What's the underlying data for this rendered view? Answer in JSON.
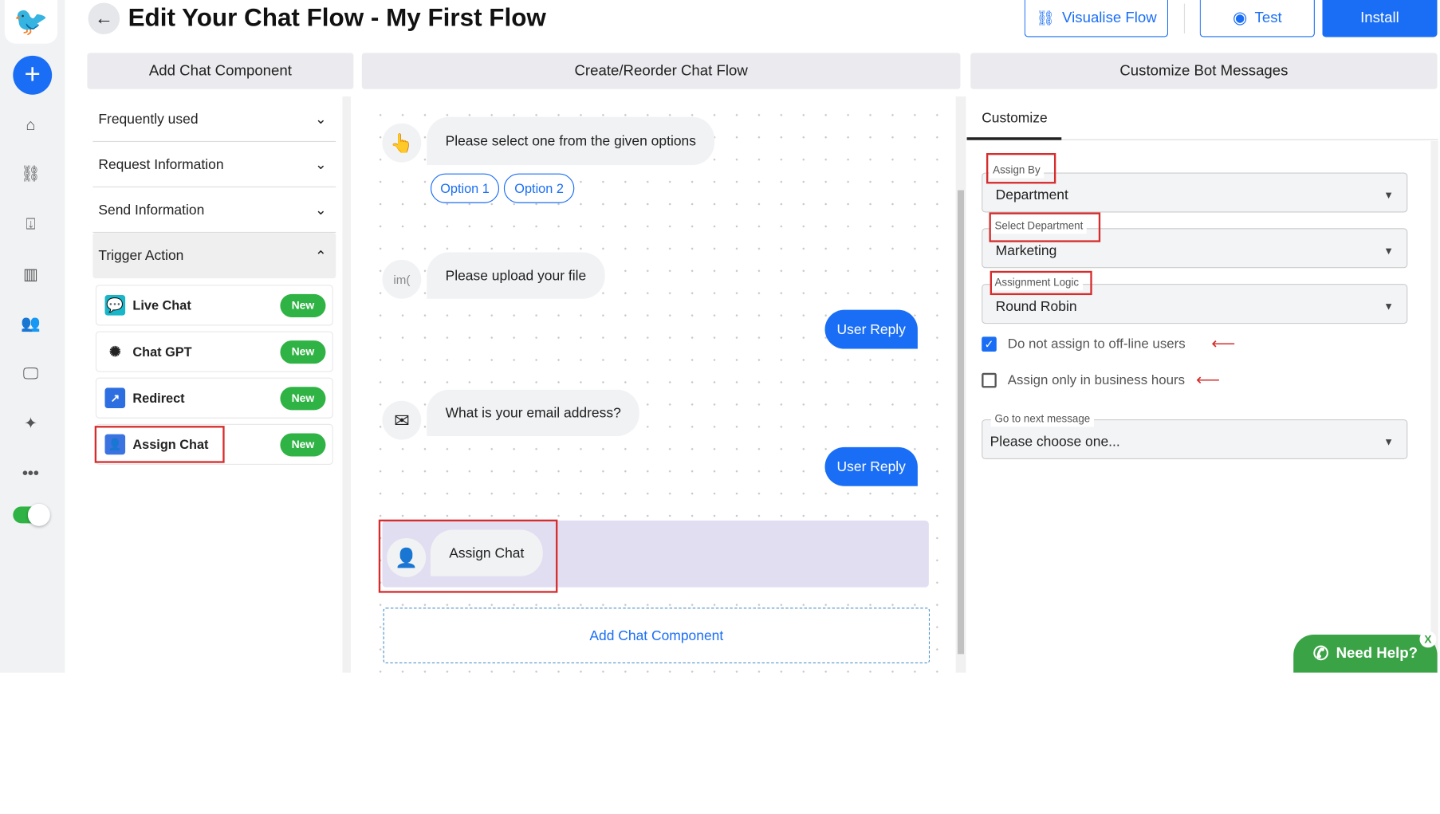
{
  "header": {
    "title": "Edit Your Chat Flow - My First Flow",
    "visualise_label": "Visualise Flow",
    "test_label": "Test",
    "install_label": "Install"
  },
  "colors": {
    "primary": "#1a6ef5",
    "new_badge": "#2fb344",
    "highlight": "#d62c2c",
    "selected_row": "#e2def2",
    "whatsapp": "#3aa346"
  },
  "sidebar": {
    "icons": [
      "logo-icon",
      "plus-icon",
      "home-icon",
      "flow-icon",
      "inbox-icon",
      "analytics-icon",
      "team-icon",
      "monitor-icon",
      "ticket-icon",
      "more-icon"
    ],
    "toggle_on": true
  },
  "left_panel": {
    "header": "Add Chat Component",
    "sections": [
      {
        "label": "Frequently used"
      },
      {
        "label": "Request Information"
      },
      {
        "label": "Send Information"
      },
      {
        "label": "Trigger Action"
      }
    ],
    "components": [
      {
        "label": "Live Chat",
        "badge": "New"
      },
      {
        "label": "Chat GPT",
        "badge": "New"
      },
      {
        "label": "Redirect",
        "badge": "New"
      },
      {
        "label": "Assign Chat",
        "badge": "New"
      }
    ]
  },
  "middle_panel": {
    "header": "Create/Reorder Chat Flow",
    "messages": [
      {
        "text": "Please select one from the given options",
        "options": [
          "Option 1",
          "Option 2"
        ]
      },
      {
        "text": "Please upload your file",
        "avatar_alt": "im("
      },
      {
        "reply": "User Reply"
      },
      {
        "text": "What is your email address?"
      },
      {
        "reply": "User Reply"
      },
      {
        "text": "Assign Chat"
      }
    ],
    "add_component": "Add Chat Component"
  },
  "right_panel": {
    "header": "Customize Bot Messages",
    "tab": "Customize",
    "fields": [
      {
        "label": "Assign By",
        "value": "Department"
      },
      {
        "label": "Select Department",
        "value": "Marketing"
      },
      {
        "label": "Assignment Logic",
        "value": "Round Robin"
      }
    ],
    "checkboxes": [
      {
        "label": "Do not assign to off-line users",
        "checked": true
      },
      {
        "label": "Assign only in business hours",
        "checked": false
      }
    ],
    "next_message": {
      "label": "Go to next message",
      "value": "Please choose one..."
    }
  },
  "help_widget": {
    "label": "Need Help?",
    "close": "X"
  }
}
